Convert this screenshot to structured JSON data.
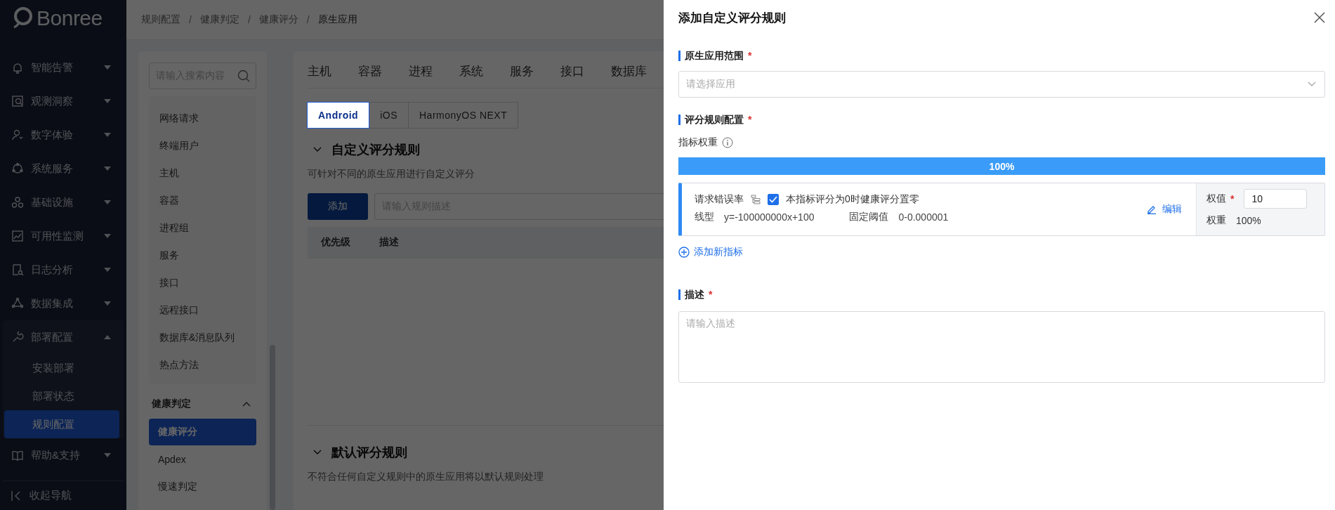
{
  "sidebar": {
    "logo": "Bonree",
    "items": [
      {
        "label": "智能告警",
        "expanded": false
      },
      {
        "label": "观测洞察",
        "expanded": false
      },
      {
        "label": "数字体验",
        "expanded": false
      },
      {
        "label": "系统服务",
        "expanded": false
      },
      {
        "label": "基础设施",
        "expanded": false
      },
      {
        "label": "可用性监测",
        "expanded": false
      },
      {
        "label": "日志分析",
        "expanded": false
      },
      {
        "label": "数据集成",
        "expanded": false
      },
      {
        "label": "部署配置",
        "expanded": true,
        "children": [
          {
            "label": "安装部署",
            "selected": false
          },
          {
            "label": "部署状态",
            "selected": false
          },
          {
            "label": "规则配置",
            "selected": true
          }
        ]
      },
      {
        "label": "帮助&支持",
        "expanded": false
      }
    ],
    "collapse": "收起导航"
  },
  "breadcrumb": {
    "separator": "/",
    "items": [
      "规则配置",
      "健康判定",
      "健康评分",
      "原生应用"
    ]
  },
  "left_panel": {
    "search": {
      "placeholder": "请输入搜索内容"
    },
    "items": [
      {
        "label": "网络请求",
        "selected": false
      },
      {
        "label": "终端用户",
        "selected": false
      },
      {
        "label": "主机",
        "selected": false
      },
      {
        "label": "容器",
        "selected": false
      },
      {
        "label": "进程组",
        "selected": false
      },
      {
        "label": "服务",
        "selected": false
      },
      {
        "label": "接口",
        "selected": false
      },
      {
        "label": "远程接口",
        "selected": false
      },
      {
        "label": "数据库&消息队列",
        "selected": false
      },
      {
        "label": "热点方法",
        "selected": false
      }
    ],
    "group": {
      "label": "健康判定",
      "expanded": true,
      "items": [
        {
          "label": "健康评分",
          "selected": true
        },
        {
          "label": "Apdex",
          "selected": false
        },
        {
          "label": "慢速判定",
          "selected": false
        }
      ]
    }
  },
  "main": {
    "tabs": [
      {
        "label": "主机",
        "selected": false
      },
      {
        "label": "容器",
        "selected": false
      },
      {
        "label": "进程",
        "selected": false
      },
      {
        "label": "系统",
        "selected": false
      },
      {
        "label": "服务",
        "selected": false
      },
      {
        "label": "接口",
        "selected": false
      },
      {
        "label": "数据库",
        "selected": false
      }
    ],
    "platforms": [
      {
        "label": "Android",
        "selected": true
      },
      {
        "label": "iOS",
        "selected": false
      },
      {
        "label": "HarmonyOS NEXT",
        "selected": false
      }
    ],
    "custom_rules": {
      "title": "自定义评分规则",
      "expanded": true,
      "description": "可针对不同的原生应用进行自定义评分",
      "add_button": "添加",
      "search": {
        "placeholder": "请输入规则描述"
      },
      "columns": [
        "优先级",
        "描述"
      ]
    },
    "default_rules": {
      "title": "默认评分规则",
      "expanded": true,
      "description": "不符合任何自定义规则中的原生应用将以默认规则处理"
    }
  },
  "drawer": {
    "title": "添加自定义评分规则",
    "scope": {
      "label": "原生应用范围",
      "required_mark": "*",
      "placeholder": "请选择应用"
    },
    "config": {
      "label": "评分规则配置",
      "required_mark": "*",
      "weight_label": "指标权重",
      "bar": {
        "level": 1,
        "text": "100%"
      },
      "metrics": [
        {
          "name": "请求错误率",
          "zero_checked": true,
          "zero_label": "本指标评分为0时健康评分置零",
          "line_label": "线型",
          "line_value": "y=-100000000x+100",
          "threshold_label": "固定阈值",
          "threshold_value": "0-0.000001",
          "edit": "编辑",
          "weight_value_label": "权值",
          "weight_required_mark": "*",
          "weight_value": "10",
          "weight_share_label": "权重",
          "weight_share": "100%"
        }
      ],
      "add_metric": "添加新指标"
    },
    "description": {
      "label": "描述",
      "required_mark": "*",
      "placeholder": "请输入描述"
    }
  }
}
